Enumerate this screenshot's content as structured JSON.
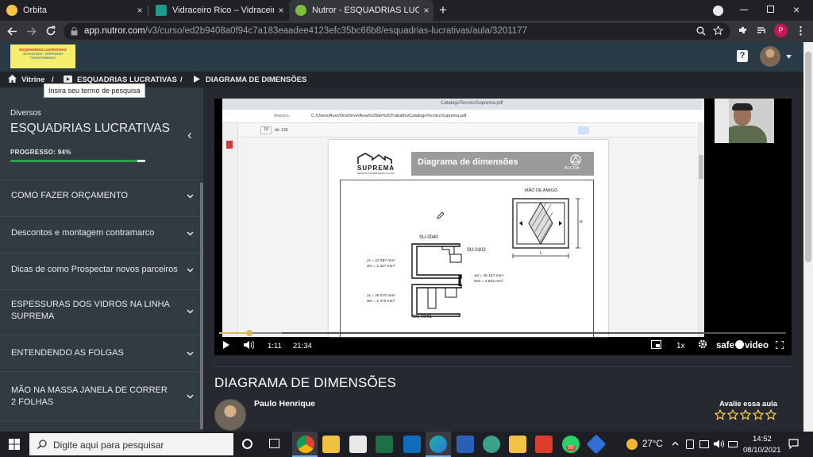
{
  "browser": {
    "tabs": [
      {
        "title": "Órbita",
        "favicon_color": "#f6c445",
        "active": false
      },
      {
        "title": "Vidraceiro Rico – Vidraceiro Rico",
        "favicon_color": "#1a9d8f",
        "active": false
      },
      {
        "title": "Nutror - ESQUADRIAS LUCRATIVAS",
        "favicon_color": "#7bbf3a",
        "active": true
      }
    ],
    "new_tab_label": "+",
    "close_glyph": "×",
    "url_domain": "app.nutror.com",
    "url_path": "/v3/curso/ed2b9408a0f94c7a183eaadee4123efc35bc66b8/esquadrias-lucrativas/aula/3201177",
    "profile_initial": "P"
  },
  "header": {
    "logo_text_lines": [
      "ESQUADRIAS LUCRATIVAS",
      "INTERAGINDO · INSPIRANDO",
      "TRANSFORMANDO"
    ],
    "help_label": "?"
  },
  "breadcrumb": {
    "home": "Vitrine",
    "separator": "/",
    "course": "ESQUADRIAS LUCRATIVAS",
    "lesson": "DIAGRAMA DE DIMENSÕES"
  },
  "tooltip": "Insira seu termo de pesquisa",
  "sidebar": {
    "category": "Diversos",
    "course_title": "ESQUADRIAS LUCRATIVAS",
    "progress_label": "PROGRESSO: 94%",
    "progress": 0.94,
    "collapse_glyph": "‹",
    "modules": [
      {
        "label": "COMO FAZER ORÇAMENTO"
      },
      {
        "label": "Descontos e montagem contramarco"
      },
      {
        "label": "Dicas de como Prospectar novos parceiros"
      },
      {
        "label": "ESPESSURAS DOS VIDROS NA LINHA SUPREMA"
      },
      {
        "label": "ENTENDENDO AS FOLGAS"
      },
      {
        "label": "MÃO NA MASSA JANELA DE CORRER 2 FOLHAS"
      }
    ]
  },
  "pdf": {
    "tab_title": "CatalogoTecnicoSuprema.pdf",
    "address_prefix": "Arquivo",
    "address": "C:/Users/Acer/OneDrive/Área%20de%20Trabalho/CatalogoTecnicoSuprema.pdf",
    "page_current": "18",
    "page_total": "de 135",
    "brand": "SUPREMA",
    "brand_sub": "PRODUTO PATENTEADO ALCOA",
    "heading": "Diagrama de dimensões",
    "alcoa": "ALCOA",
    "mao_de_amigo": "MÃO DE AMIGO",
    "dim_h": "H",
    "dim_l": "L",
    "profiles": [
      "SU-0040",
      "SU-0102",
      "SU-0041"
    ],
    "specs": [
      [
        "Jx = 22 597 mm⁴",
        "Wx = 1 347 mm³"
      ],
      [
        "Jxt = 49 167 mm⁴",
        "Wxt = 2 823 mm³"
      ],
      [
        "Jx = 26 570 mm⁴",
        "Wx = 1 476 mm³"
      ]
    ]
  },
  "video": {
    "progress": 0.053,
    "buffered": 0.11,
    "current_time": "1:11",
    "duration": "21:34",
    "speed": "1x",
    "brand": "safe",
    "brand_suffix": "video"
  },
  "lesson": {
    "title": "DIAGRAMA DE DIMENSÕES",
    "author": "Paulo Henrique",
    "rate_label": "Avalie essa aula",
    "stars": 5
  },
  "taskbar": {
    "search_placeholder": "Digite aqui para pesquisar",
    "weather": "27°C",
    "time": "14:52",
    "date": "08/10/2021",
    "badge": "99"
  },
  "colors": {
    "accent_yellow": "#d9b95a",
    "progress_green": "#2ea043",
    "star": "#f2c94c"
  }
}
